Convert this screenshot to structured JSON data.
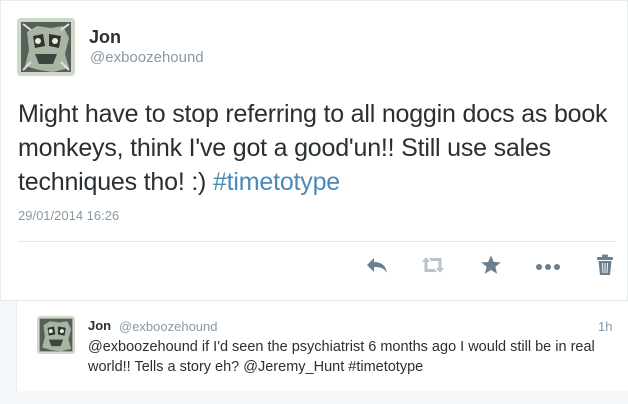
{
  "tweet": {
    "author_name": "Jon",
    "author_handle": "@exboozehound",
    "text_body": "Might have to stop referring to all noggin docs as book monkeys, think I've got a good'un!! Still use sales techniques tho! :) ",
    "hashtag": "#timetotype",
    "date": "29/01/2014 16:26"
  },
  "actions": [
    {
      "name": "reply",
      "icon": "reply-icon"
    },
    {
      "name": "retweet",
      "icon": "retweet-icon"
    },
    {
      "name": "favorite",
      "icon": "star-icon"
    },
    {
      "name": "more",
      "icon": "more-icon"
    },
    {
      "name": "delete",
      "icon": "trash-icon"
    }
  ],
  "reply": {
    "author_name": "Jon",
    "author_handle": "@exboozehound",
    "time": "1h",
    "text": "@exboozehound if I'd seen the psychiatrist 6 months ago I would still be in real world!! Tells a story eh? @Jeremy_Hunt #timetotype"
  },
  "colors": {
    "text": "#292f33",
    "muted": "#8899a6",
    "link": "#4a8ab8",
    "icon": "#6b7f8e",
    "background_alt": "#f5f8fa"
  }
}
